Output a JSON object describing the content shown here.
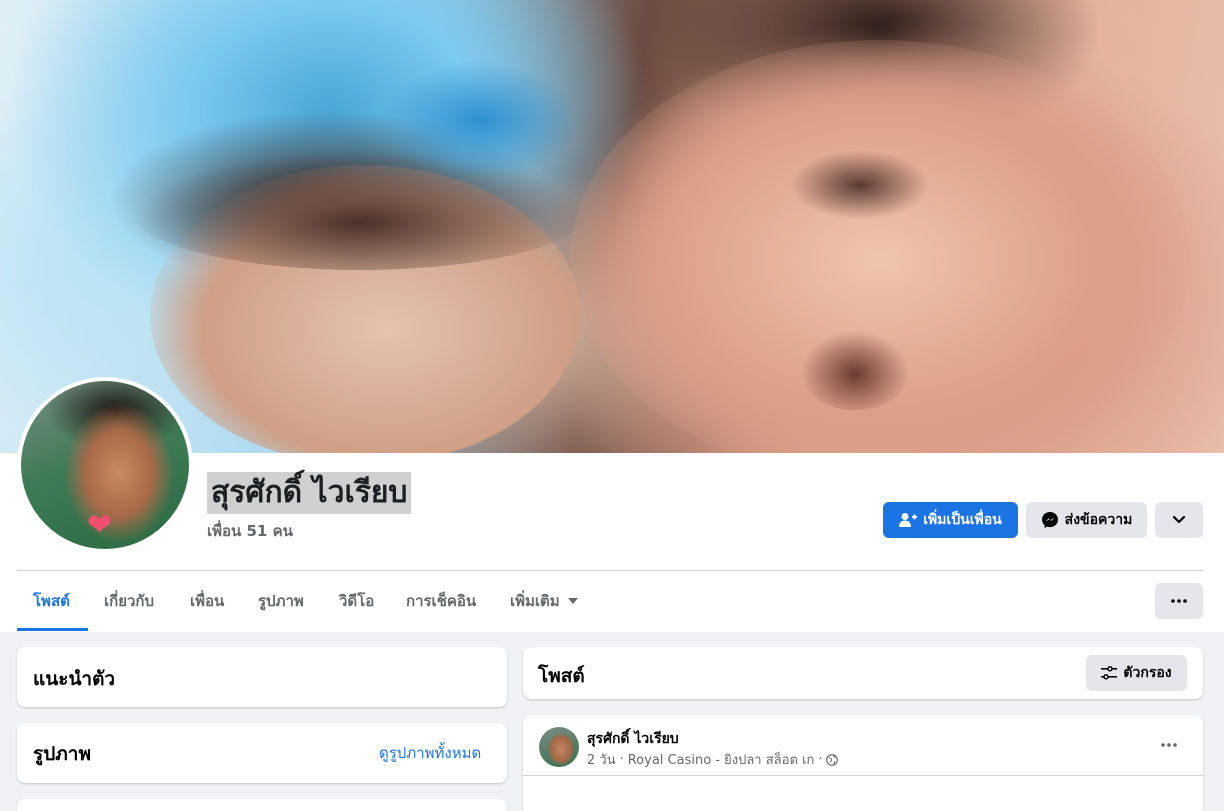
{
  "profile": {
    "name": "สุรศักดิ์ ไวเรียบ",
    "friends": "เพื่อน 51 คน"
  },
  "actions": {
    "add_friend": "เพิ่มเป็นเพื่อน",
    "message": "ส่งข้อความ"
  },
  "tabs": [
    {
      "label": "โพสต์",
      "active": true
    },
    {
      "label": "เกี่ยวกับ"
    },
    {
      "label": "เพื่อน"
    },
    {
      "label": "รูปภาพ"
    },
    {
      "label": "วิดีโอ"
    },
    {
      "label": "การเช็คอิน"
    },
    {
      "label": "เพิ่มเติม"
    }
  ],
  "intro": {
    "title": "แนะนำตัว"
  },
  "photos": {
    "title": "รูปภาพ",
    "see_all": "ดูรูปภาพทั้งหมด"
  },
  "posts_panel": {
    "title": "โพสต์",
    "filter": "ตัวกรอง"
  },
  "post": {
    "author": "สุรศักดิ์ ไวเรียบ",
    "time": "2 วัน",
    "location": "Royal Casino - ยิงปลา สล็อต เก"
  },
  "colors": {
    "accent": "#1b74e4",
    "secondary_button": "#e4e6eb",
    "page_background": "#f0f2f5"
  }
}
